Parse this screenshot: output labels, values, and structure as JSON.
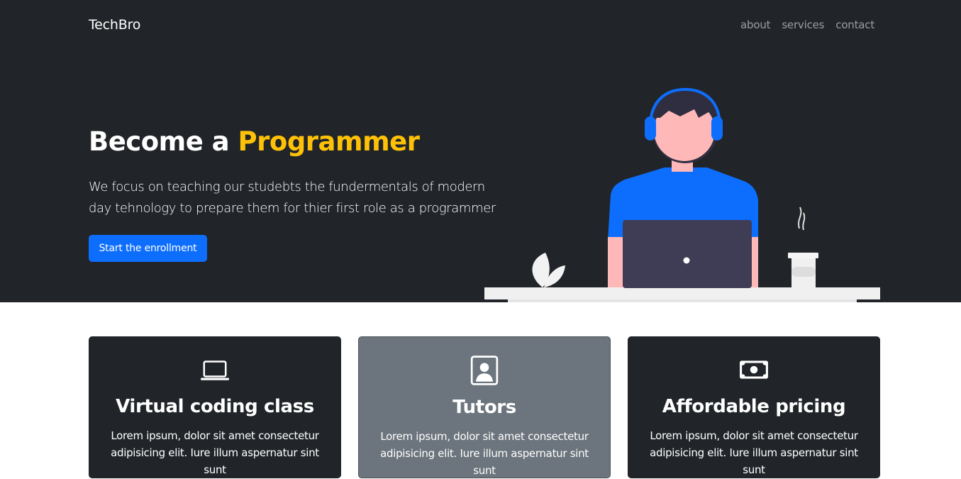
{
  "navbar": {
    "brand": "TechBro",
    "links": [
      "about",
      "services",
      "contact"
    ]
  },
  "hero": {
    "title_prefix": "Become a ",
    "title_accent": "Programmer",
    "lead": "We focus on teaching our studebts the fundermentals of modern day tehnology to prepare them for thier first role as a programmer",
    "cta_label": "Start the enrollment",
    "illustration_icon": "person-with-headphones-at-laptop-illustration"
  },
  "features": [
    {
      "icon": "laptop-icon",
      "title": "Virtual coding class",
      "text": "Lorem ipsum, dolor sit amet consectetur adipisicing elit. Iure illum aspernatur sint sunt"
    },
    {
      "icon": "person-badge-icon",
      "title": "Tutors",
      "text": "Lorem ipsum, dolor sit amet consectetur adipisicing elit. Iure illum aspernatur sint sunt"
    },
    {
      "icon": "cash-icon",
      "title": "Affordable pricing",
      "text": "Lorem ipsum, dolor sit amet consectetur adipisicing elit. Iure illum aspernatur sint sunt"
    }
  ],
  "colors": {
    "dark": "#212529",
    "accent": "#ffc107",
    "primary": "#0d6efd",
    "gray": "#6c757d"
  }
}
